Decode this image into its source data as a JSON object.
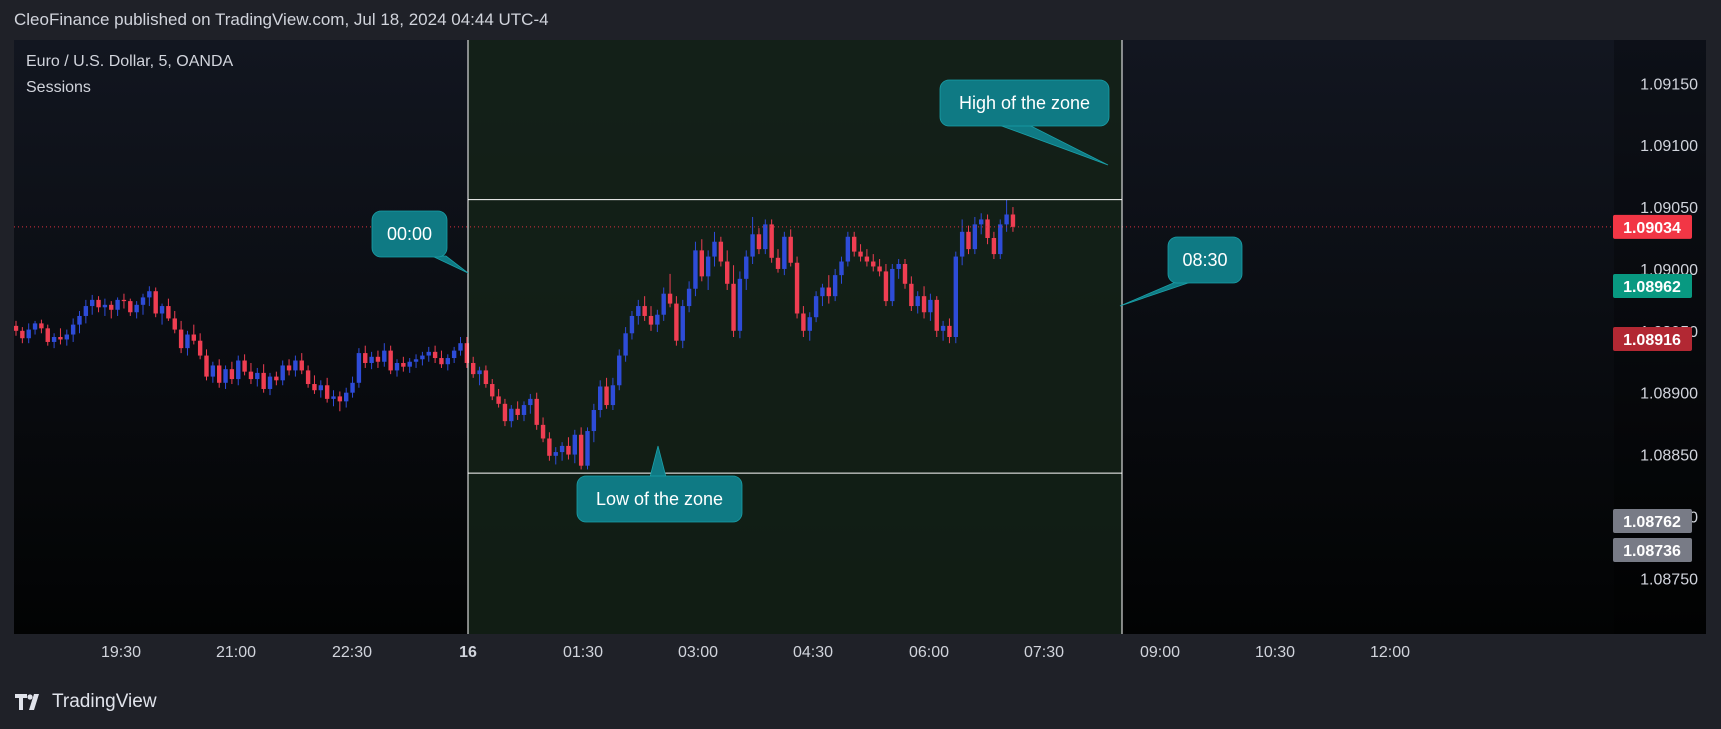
{
  "header": {
    "published": "CleoFinance published on TradingView.com, Jul 18, 2024 04:44 UTC-4"
  },
  "legend": {
    "symbol": "Euro / U.S. Dollar, 5, OANDA",
    "indicator": "Sessions"
  },
  "footer": {
    "brand": "TradingView"
  },
  "colors": {
    "bull": "#2e4cd8",
    "bear": "#ef3e52",
    "callout": "#0f7a84",
    "zone_fill": "#142218",
    "zone_line": "#ffffff",
    "current_price_line": "#d8303e"
  },
  "annotations": {
    "zone_start": "00:00",
    "zone_end": "08:30",
    "zone_high": "High of the zone",
    "zone_low": "Low of the zone"
  },
  "chart_data": {
    "type": "candlestick",
    "symbol": "EURUSD",
    "timeframe": "5",
    "x_tick_labels": [
      "19:30",
      "21:00",
      "22:30",
      "16",
      "01:30",
      "03:00",
      "04:30",
      "06:00",
      "07:30",
      "09:00",
      "10:30",
      "12:00"
    ],
    "y_tick_labels": [
      "1.09150",
      "1.09100",
      "1.09050",
      "1.09000",
      "1.08950",
      "1.08900",
      "1.08850",
      "1.08800",
      "1.08750"
    ],
    "price_labels": [
      {
        "value": "1.09034",
        "color": "#f23645"
      },
      {
        "value": "1.08962",
        "color": "#089981"
      },
      {
        "value": "1.08916",
        "color": "#b22833"
      },
      {
        "value": "1.08762",
        "color": "#787b86"
      },
      {
        "value": "1.08736",
        "color": "#787b86"
      }
    ],
    "zone": {
      "start": "00:00",
      "end": "08:30",
      "high": 1.09056,
      "low": 1.08835
    },
    "current_price": 1.09034,
    "ylim": [
      1.08705,
      1.09185
    ],
    "candles": [
      [
        1.08954,
        1.08958,
        1.08946,
        1.0895
      ],
      [
        1.0895,
        1.08953,
        1.0894,
        1.08944
      ],
      [
        1.08944,
        1.08956,
        1.0894,
        1.08951
      ],
      [
        1.08951,
        1.08958,
        1.08947,
        1.08956
      ],
      [
        1.08956,
        1.08959,
        1.08948,
        1.08952
      ],
      [
        1.08952,
        1.08955,
        1.08938,
        1.08941
      ],
      [
        1.08941,
        1.08948,
        1.08936,
        1.08945
      ],
      [
        1.08945,
        1.08952,
        1.08939,
        1.08943
      ],
      [
        1.08943,
        1.08951,
        1.08938,
        1.08947
      ],
      [
        1.08947,
        1.0896,
        1.08941,
        1.08955
      ],
      [
        1.08955,
        1.08966,
        1.08948,
        1.08962
      ],
      [
        1.08962,
        1.08975,
        1.08956,
        1.0897
      ],
      [
        1.0897,
        1.08979,
        1.08963,
        1.08975
      ],
      [
        1.08975,
        1.08978,
        1.08965,
        1.08969
      ],
      [
        1.08969,
        1.08976,
        1.08962,
        1.08971
      ],
      [
        1.08971,
        1.08974,
        1.0896,
        1.08967
      ],
      [
        1.08967,
        1.08977,
        1.08962,
        1.08975
      ],
      [
        1.08975,
        1.0898,
        1.08968,
        1.08974
      ],
      [
        1.08974,
        1.08976,
        1.08962,
        1.08965
      ],
      [
        1.08965,
        1.08974,
        1.0896,
        1.08971
      ],
      [
        1.08971,
        1.0898,
        1.08963,
        1.08977
      ],
      [
        1.08977,
        1.08986,
        1.0897,
        1.08982
      ],
      [
        1.08982,
        1.08985,
        1.08961,
        1.08964
      ],
      [
        1.08964,
        1.08972,
        1.08955,
        1.0897
      ],
      [
        1.0897,
        1.08976,
        1.08958,
        1.0896
      ],
      [
        1.0896,
        1.08966,
        1.08948,
        1.08951
      ],
      [
        1.08951,
        1.08958,
        1.08932,
        1.08936
      ],
      [
        1.08936,
        1.0895,
        1.0893,
        1.08947
      ],
      [
        1.08947,
        1.08955,
        1.08939,
        1.08942
      ],
      [
        1.08942,
        1.08948,
        1.08927,
        1.0893
      ],
      [
        1.0893,
        1.08935,
        1.0891,
        1.08913
      ],
      [
        1.08913,
        1.08925,
        1.08908,
        1.08922
      ],
      [
        1.08922,
        1.08927,
        1.08904,
        1.08908
      ],
      [
        1.08908,
        1.08922,
        1.08903,
        1.08919
      ],
      [
        1.08919,
        1.08925,
        1.08907,
        1.08911
      ],
      [
        1.08911,
        1.0893,
        1.08906,
        1.08926
      ],
      [
        1.08926,
        1.08931,
        1.08914,
        1.08917
      ],
      [
        1.08917,
        1.08924,
        1.08907,
        1.08911
      ],
      [
        1.08911,
        1.0892,
        1.08905,
        1.08916
      ],
      [
        1.08916,
        1.08923,
        1.089,
        1.08903
      ],
      [
        1.08903,
        1.08916,
        1.08898,
        1.08913
      ],
      [
        1.08913,
        1.08917,
        1.08906,
        1.0891
      ],
      [
        1.0891,
        1.08926,
        1.08906,
        1.08922
      ],
      [
        1.08922,
        1.08927,
        1.08914,
        1.08918
      ],
      [
        1.08918,
        1.0893,
        1.08913,
        1.08926
      ],
      [
        1.08926,
        1.08932,
        1.08915,
        1.08918
      ],
      [
        1.08918,
        1.08922,
        1.08904,
        1.08907
      ],
      [
        1.08907,
        1.08914,
        1.08899,
        1.08902
      ],
      [
        1.08902,
        1.0891,
        1.08896,
        1.08906
      ],
      [
        1.08906,
        1.08912,
        1.08892,
        1.08895
      ],
      [
        1.08895,
        1.08902,
        1.08889,
        1.08897
      ],
      [
        1.08897,
        1.08901,
        1.08885,
        1.08893
      ],
      [
        1.08893,
        1.08904,
        1.08888,
        1.089
      ],
      [
        1.089,
        1.08913,
        1.08896,
        1.08908
      ],
      [
        1.08908,
        1.08936,
        1.08904,
        1.08932
      ],
      [
        1.08932,
        1.08938,
        1.0892,
        1.08924
      ],
      [
        1.08924,
        1.08933,
        1.08919,
        1.08929
      ],
      [
        1.08929,
        1.08934,
        1.0892,
        1.08925
      ],
      [
        1.08925,
        1.0894,
        1.08921,
        1.08934
      ],
      [
        1.08934,
        1.08938,
        1.08915,
        1.08918
      ],
      [
        1.08918,
        1.08927,
        1.08913,
        1.08924
      ],
      [
        1.08924,
        1.08929,
        1.08917,
        1.08921
      ],
      [
        1.08921,
        1.08928,
        1.08916,
        1.08925
      ],
      [
        1.08925,
        1.08931,
        1.0892,
        1.08927
      ],
      [
        1.08927,
        1.08933,
        1.08922,
        1.0893
      ],
      [
        1.0893,
        1.08937,
        1.08925,
        1.08933
      ],
      [
        1.08933,
        1.08938,
        1.08924,
        1.08928
      ],
      [
        1.08928,
        1.08934,
        1.0892,
        1.08923
      ],
      [
        1.08923,
        1.08931,
        1.08918,
        1.08928
      ],
      [
        1.08928,
        1.08937,
        1.08924,
        1.08934
      ],
      [
        1.08934,
        1.08945,
        1.0893,
        1.0894
      ],
      [
        1.0894,
        1.08945,
        1.0892,
        1.08924
      ],
      [
        1.08924,
        1.08929,
        1.08912,
        1.08915
      ],
      [
        1.08915,
        1.08921,
        1.08906,
        1.08918
      ],
      [
        1.08918,
        1.08922,
        1.08904,
        1.08907
      ],
      [
        1.08907,
        1.08911,
        1.08894,
        1.08897
      ],
      [
        1.08897,
        1.08903,
        1.08888,
        1.08891
      ],
      [
        1.08891,
        1.08895,
        1.08873,
        1.08877
      ],
      [
        1.08877,
        1.0889,
        1.08872,
        1.08887
      ],
      [
        1.08887,
        1.08893,
        1.08878,
        1.08882
      ],
      [
        1.08882,
        1.08893,
        1.08877,
        1.0889
      ],
      [
        1.0889,
        1.08899,
        1.08883,
        1.08895
      ],
      [
        1.08895,
        1.089,
        1.0887,
        1.08874
      ],
      [
        1.08874,
        1.0888,
        1.0886,
        1.08863
      ],
      [
        1.08863,
        1.08868,
        1.08845,
        1.08849
      ],
      [
        1.08849,
        1.08856,
        1.08842,
        1.08852
      ],
      [
        1.08852,
        1.0886,
        1.08845,
        1.08857
      ],
      [
        1.08857,
        1.08864,
        1.08846,
        1.0885
      ],
      [
        1.0885,
        1.0887,
        1.08843,
        1.08866
      ],
      [
        1.08866,
        1.08872,
        1.08838,
        1.08841
      ],
      [
        1.08841,
        1.08872,
        1.08838,
        1.08869
      ],
      [
        1.08869,
        1.08891,
        1.0886,
        1.08886
      ],
      [
        1.08886,
        1.0891,
        1.0888,
        1.08905
      ],
      [
        1.08905,
        1.08912,
        1.08887,
        1.0889
      ],
      [
        1.0889,
        1.08912,
        1.08886,
        1.08906
      ],
      [
        1.08906,
        1.08935,
        1.08902,
        1.0893
      ],
      [
        1.0893,
        1.08953,
        1.08925,
        1.08948
      ],
      [
        1.08948,
        1.08966,
        1.08943,
        1.08962
      ],
      [
        1.08962,
        1.08975,
        1.08955,
        1.0897
      ],
      [
        1.0897,
        1.08978,
        1.08958,
        1.08962
      ],
      [
        1.08962,
        1.0897,
        1.0895,
        1.08955
      ],
      [
        1.08955,
        1.08967,
        1.08949,
        1.08963
      ],
      [
        1.08963,
        1.08985,
        1.08958,
        1.0898
      ],
      [
        1.0898,
        1.08996,
        1.08969,
        1.08972
      ],
      [
        1.08972,
        1.08978,
        1.08938,
        1.08942
      ],
      [
        1.08942,
        1.08975,
        1.08936,
        1.0897
      ],
      [
        1.0897,
        1.0899,
        1.08965,
        1.08984
      ],
      [
        1.08984,
        1.09022,
        1.08978,
        1.09015
      ],
      [
        1.09015,
        1.09024,
        1.0899,
        1.08994
      ],
      [
        1.08994,
        1.09015,
        1.08983,
        1.0901
      ],
      [
        1.0901,
        1.0903,
        1.09002,
        1.09022
      ],
      [
        1.09022,
        1.09026,
        1.09002,
        1.09006
      ],
      [
        1.09006,
        1.09015,
        1.08983,
        1.08988
      ],
      [
        1.08988,
        1.09003,
        1.08945,
        1.0895
      ],
      [
        1.0895,
        1.08998,
        1.08944,
        1.08992
      ],
      [
        1.08992,
        1.09015,
        1.08983,
        1.0901
      ],
      [
        1.0901,
        1.09042,
        1.09004,
        1.09028
      ],
      [
        1.09028,
        1.09033,
        1.09012,
        1.09016
      ],
      [
        1.09016,
        1.0904,
        1.09012,
        1.09036
      ],
      [
        1.09036,
        1.0904,
        1.09005,
        1.09009
      ],
      [
        1.09009,
        1.09016,
        1.08997,
        1.09
      ],
      [
        1.09,
        1.0903,
        1.08995,
        1.09026
      ],
      [
        1.09026,
        1.09032,
        1.09002,
        1.09005
      ],
      [
        1.09005,
        1.0901,
        1.0896,
        1.08964
      ],
      [
        1.08964,
        1.0897,
        1.08945,
        1.0895
      ],
      [
        1.0895,
        1.08965,
        1.08942,
        1.08961
      ],
      [
        1.08961,
        1.08982,
        1.08957,
        1.08978
      ],
      [
        1.08978,
        1.08988,
        1.0897,
        1.08985
      ],
      [
        1.08985,
        1.08995,
        1.08972,
        1.08978
      ],
      [
        1.08978,
        1.09,
        1.08974,
        1.08995
      ],
      [
        1.08995,
        1.0901,
        1.08988,
        1.09006
      ],
      [
        1.09006,
        1.0903,
        1.09002,
        1.09026
      ],
      [
        1.09026,
        1.0903,
        1.0901,
        1.09014
      ],
      [
        1.09014,
        1.0902,
        1.09006,
        1.0901
      ],
      [
        1.0901,
        1.09016,
        1.09002,
        1.09006
      ],
      [
        1.09006,
        1.09012,
        1.08998,
        1.09002
      ],
      [
        1.09002,
        1.09008,
        1.08994,
        1.08998
      ],
      [
        1.08998,
        1.09004,
        1.0897,
        1.08974
      ],
      [
        1.08974,
        1.09004,
        1.0897,
        1.09
      ],
      [
        1.09,
        1.09008,
        1.08992,
        1.09004
      ],
      [
        1.09004,
        1.09008,
        1.08984,
        1.08988
      ],
      [
        1.08988,
        1.08994,
        1.08966,
        1.0897
      ],
      [
        1.0897,
        1.08982,
        1.08964,
        1.08978
      ],
      [
        1.08978,
        1.08986,
        1.0896,
        1.08965
      ],
      [
        1.08965,
        1.0898,
        1.08958,
        1.08975
      ],
      [
        1.08975,
        1.08978,
        1.08945,
        1.0895
      ],
      [
        1.0895,
        1.08958,
        1.08942,
        1.08954
      ],
      [
        1.08954,
        1.0896,
        1.0894,
        1.08945
      ],
      [
        1.08945,
        1.09014,
        1.0894,
        1.0901
      ],
      [
        1.0901,
        1.0904,
        1.09003,
        1.0903
      ],
      [
        1.0903,
        1.09035,
        1.09012,
        1.09016
      ],
      [
        1.09016,
        1.09042,
        1.09012,
        1.09036
      ],
      [
        1.09036,
        1.09045,
        1.09028,
        1.0904
      ],
      [
        1.0904,
        1.09044,
        1.0902,
        1.09025
      ],
      [
        1.09025,
        1.0903,
        1.09008,
        1.09012
      ],
      [
        1.09012,
        1.0904,
        1.09008,
        1.09036
      ],
      [
        1.09036,
        1.09056,
        1.0903,
        1.09044
      ],
      [
        1.09044,
        1.0905,
        1.0903,
        1.09034
      ]
    ]
  }
}
